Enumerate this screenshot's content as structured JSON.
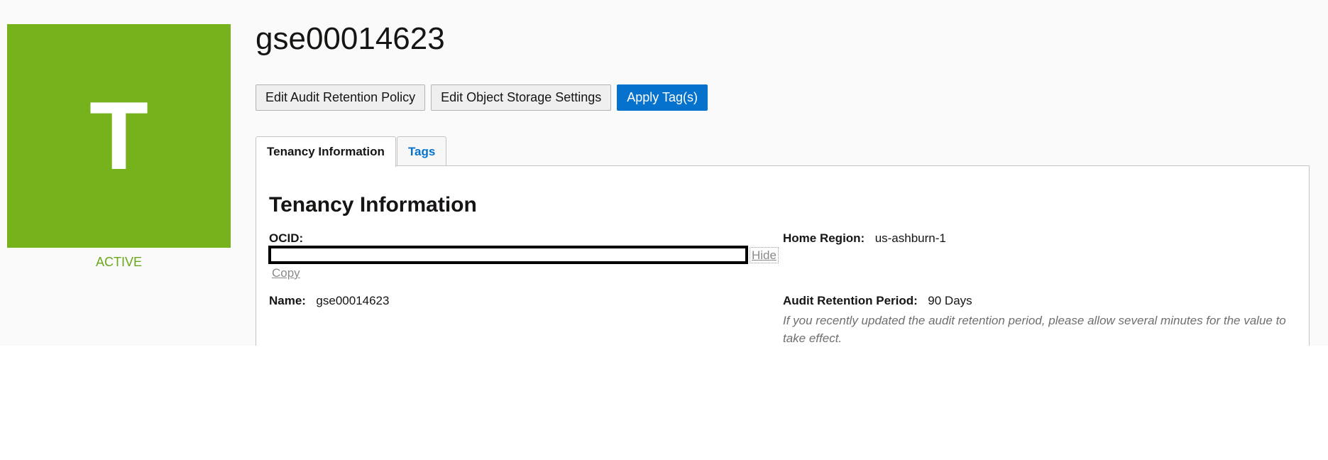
{
  "avatar": {
    "letter": "T",
    "color": "#75b21b"
  },
  "status": {
    "text": "ACTIVE",
    "color": "#6aa71b"
  },
  "title": "gse00014623",
  "actions": {
    "edit_audit_retention": "Edit Audit Retention Policy",
    "edit_object_storage": "Edit Object Storage Settings",
    "apply_tags": "Apply Tag(s)",
    "primary_color": "#0572ce"
  },
  "tabs": [
    {
      "label": "Tenancy Information",
      "active": true
    },
    {
      "label": "Tags",
      "active": false
    }
  ],
  "panel": {
    "heading": "Tenancy Information",
    "ocid": {
      "label": "OCID:",
      "value": "",
      "hide_label": "Hide",
      "copy_label": "Copy"
    },
    "name": {
      "label": "Name:",
      "value": "gse00014623"
    },
    "home_region": {
      "label": "Home Region:",
      "value": "us-ashburn-1"
    },
    "audit_retention": {
      "label": "Audit Retention Period:",
      "value": "90 Days",
      "note": "If you recently updated the audit retention period, please allow several minutes for the value to take effect."
    }
  }
}
